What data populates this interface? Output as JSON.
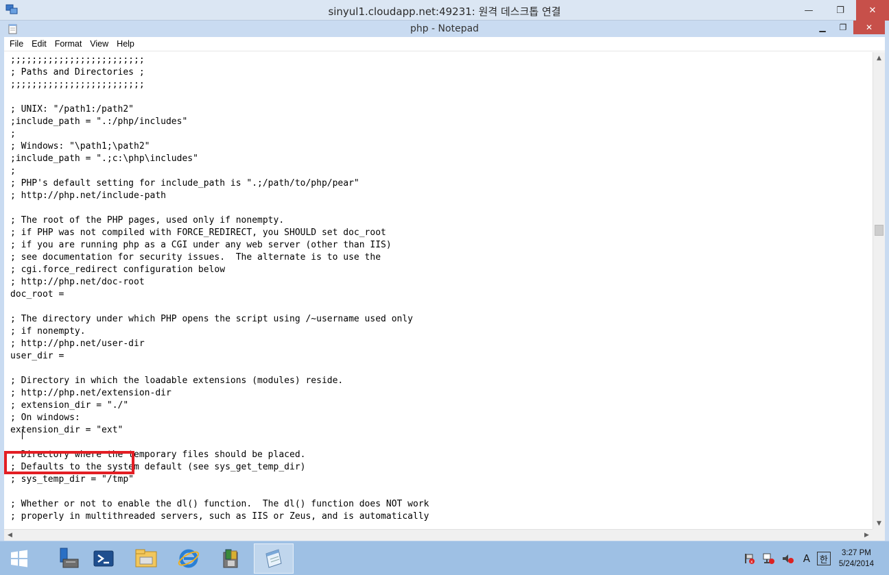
{
  "rdp": {
    "title": "sinyul1.cloudapp.net:49231: 원격 데스크톱 연결",
    "controls": {
      "minimize": "—",
      "restore": "❐",
      "close": "✕"
    }
  },
  "notepad": {
    "title": "php - Notepad",
    "controls": {
      "minimize": "▁",
      "restore": "❐",
      "close": "✕"
    },
    "menu": [
      "File",
      "Edit",
      "Format",
      "View",
      "Help"
    ],
    "lines": [
      ";;;;;;;;;;;;;;;;;;;;;;;;;",
      "; Paths and Directories ;",
      ";;;;;;;;;;;;;;;;;;;;;;;;;",
      "",
      "; UNIX: \"/path1:/path2\"",
      ";include_path = \".:/php/includes\"",
      ";",
      "; Windows: \"\\path1;\\path2\"",
      ";include_path = \".;c:\\php\\includes\"",
      ";",
      "; PHP's default setting for include_path is \".;/path/to/php/pear\"",
      "; http://php.net/include-path",
      "",
      "; The root of the PHP pages, used only if nonempty.",
      "; if PHP was not compiled with FORCE_REDIRECT, you SHOULD set doc_root",
      "; if you are running php as a CGI under any web server (other than IIS)",
      "; see documentation for security issues.  The alternate is to use the",
      "; cgi.force_redirect configuration below",
      "; http://php.net/doc-root",
      "doc_root =",
      "",
      "; The directory under which PHP opens the script using /~username used only",
      "; if nonempty.",
      "; http://php.net/user-dir",
      "user_dir =",
      "",
      "; Directory in which the loadable extensions (modules) reside.",
      "; http://php.net/extension-dir",
      "; extension_dir = \"./\"",
      "; On windows:",
      "extension_dir = \"ext\"",
      "",
      "; Directory where the temporary files should be placed.",
      "; Defaults to the system default (see sys_get_temp_dir)",
      "; sys_temp_dir = \"/tmp\"",
      "",
      "; Whether or not to enable the dl() function.  The dl() function does NOT work",
      "; properly in multithreaded servers, such as IIS or Zeus, and is automatically"
    ]
  },
  "taskbar": {
    "apps": [
      {
        "name": "server-manager",
        "active": false
      },
      {
        "name": "powershell",
        "active": false
      },
      {
        "name": "file-explorer",
        "active": false
      },
      {
        "name": "internet-explorer",
        "active": false
      },
      {
        "name": "tool-app",
        "active": false
      },
      {
        "name": "notepad",
        "active": true
      }
    ],
    "tray": {
      "ime_mode": "A",
      "ime_lang": "한"
    },
    "clock": {
      "time": "3:27 PM",
      "date": "5/24/2014"
    }
  },
  "colors": {
    "highlight": "#e31e24",
    "taskbar": "#9ec0e4",
    "titlebar": "#c9dbf1"
  }
}
